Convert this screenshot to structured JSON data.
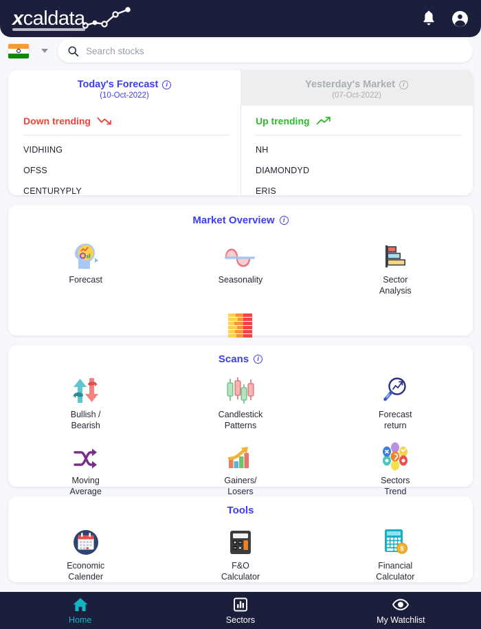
{
  "brand": {
    "name_x": "x",
    "name_rest": "caldata",
    "logo_icon": "line-chart-spark-icon"
  },
  "topbar": {
    "notifications_icon": "bell-icon",
    "account_icon": "account-circle-icon",
    "bg_color": "#1b1f3b"
  },
  "search": {
    "country_flag": "india-flag-icon",
    "dropdown_icon": "chevron-down-icon",
    "search_icon": "search-icon",
    "placeholder": "Search stocks",
    "value": ""
  },
  "forecast": {
    "today": {
      "title": "Today's Forecast",
      "info_icon": "info-icon",
      "date": "(10-Oct-2022)",
      "trend_label": "Down trending",
      "trend_icon": "trend-down-icon",
      "trend_color": "#f0443a",
      "stocks": [
        "VIDHIING",
        "OFSS",
        "CENTURYPLY"
      ]
    },
    "yesterday": {
      "title": "Yesterday's Market",
      "info_icon": "info-icon",
      "date": "(07-Oct-2022)",
      "trend_label": "Up trending",
      "trend_icon": "trend-up-icon",
      "trend_color": "#2eb82e",
      "stocks": [
        "NH",
        "DIAMONDYD",
        "ERIS"
      ]
    }
  },
  "market_overview": {
    "title": "Market Overview",
    "info_icon": "info-icon",
    "tiles": [
      {
        "label": "Forecast",
        "icon": "forecast-head-icon"
      },
      {
        "label": "Seasonality",
        "icon": "sine-wave-icon"
      },
      {
        "label": "Sector\nAnalysis",
        "icon": "horizontal-bar-chart-icon"
      },
      {
        "label": "Heat Map",
        "icon": "heat-map-icon"
      }
    ]
  },
  "scans": {
    "title": "Scans",
    "info_icon": "info-icon",
    "tiles": [
      {
        "label": "Bullish /\nBearish",
        "icon": "bull-bear-arrows-icon"
      },
      {
        "label": "Candlestick\nPatterns",
        "icon": "candlestick-icon"
      },
      {
        "label": "Forecast\nreturn",
        "icon": "magnifier-trend-icon"
      },
      {
        "label": "Moving\nAverage",
        "icon": "shuffle-arrows-icon"
      },
      {
        "label": "Gainers/\nLosers",
        "icon": "bar-chart-arrow-up-icon"
      },
      {
        "label": "Sectors\nTrend",
        "icon": "sector-cluster-icon"
      }
    ]
  },
  "tools": {
    "title": "Tools",
    "tiles": [
      {
        "label": "Economic\nCalender",
        "icon": "calendar-icon"
      },
      {
        "label": "F&O\nCalculator",
        "icon": "calculator-dark-icon"
      },
      {
        "label": "Financial\nCalculator",
        "icon": "calculator-coin-icon"
      }
    ]
  },
  "bottom_nav": {
    "active_color": "#12b5c4",
    "items": [
      {
        "label": "Home",
        "icon": "home-icon",
        "active": true
      },
      {
        "label": "Sectors",
        "icon": "bar-chart-box-icon",
        "active": false
      },
      {
        "label": "My Watchlist",
        "icon": "eye-icon",
        "active": false
      }
    ]
  }
}
